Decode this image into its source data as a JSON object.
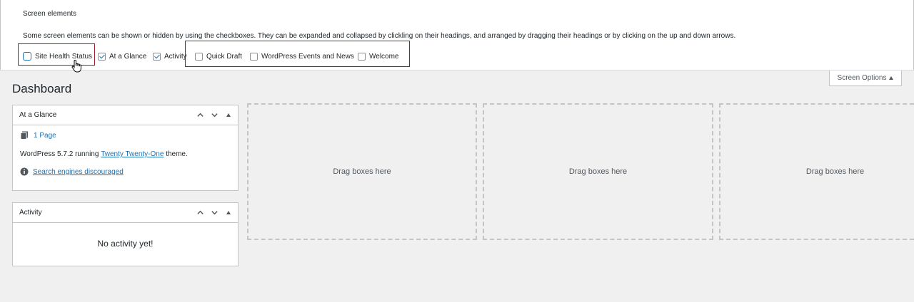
{
  "screen_options": {
    "title": "Screen elements",
    "description": "Some screen elements can be shown or hidden by using the checkboxes. They can be expanded and collapsed by clickling on their headings, and arranged by dragging their headings or by clicking on the up and down arrows.",
    "checkboxes": [
      {
        "label": "Site Health Status",
        "checked": false
      },
      {
        "label": "At a Glance",
        "checked": true
      },
      {
        "label": "Activity",
        "checked": true
      },
      {
        "label": "Quick Draft",
        "checked": false
      },
      {
        "label": "WordPress Events and News",
        "checked": false
      },
      {
        "label": "Welcome",
        "checked": false
      }
    ],
    "toggle_label": "Screen Options",
    "highlight_color": "#9a1a2a"
  },
  "page": {
    "title": "Dashboard"
  },
  "at_a_glance": {
    "title": "At a Glance",
    "pages": "1 Page",
    "version_prefix": "WordPress 5.7.2 running ",
    "theme": "Twenty Twenty-One",
    "version_suffix": " theme.",
    "search_notice": "Search engines discouraged"
  },
  "activity": {
    "title": "Activity",
    "empty": "No activity yet!"
  },
  "drop_zones": {
    "label": "Drag boxes here"
  },
  "colors": {
    "link": "#2271b1",
    "background": "#f0f0f1"
  }
}
